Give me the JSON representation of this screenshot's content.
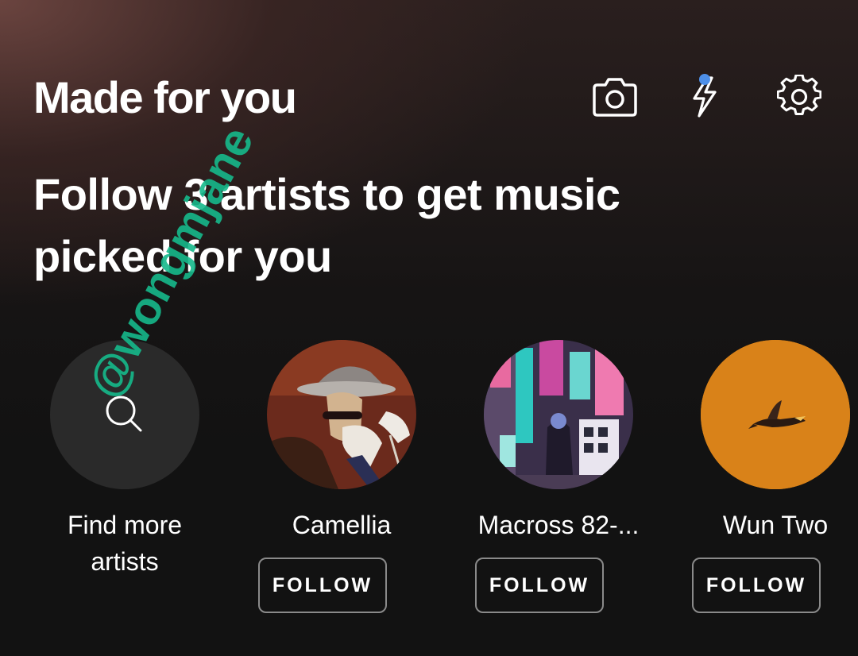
{
  "header": {
    "title": "Made for you",
    "icons": [
      "camera-icon",
      "lightning-bolt-icon",
      "settings-gear-icon"
    ],
    "notification_dot_color": "#4d8fe8"
  },
  "main": {
    "subtitle": "Follow 3 artists to get music picked for you",
    "find_more_label": "Find more artists",
    "artists": [
      {
        "name": "Camellia",
        "follow_label": "FOLLOW"
      },
      {
        "name": "Macross 82-...",
        "follow_label": "FOLLOW"
      },
      {
        "name": "Wun Two",
        "follow_label": "FOLLOW"
      }
    ]
  },
  "watermark": "@wongmjane",
  "colors": {
    "background": "#121212",
    "accent_orange": "#d98219",
    "watermark": "#16b98b"
  }
}
